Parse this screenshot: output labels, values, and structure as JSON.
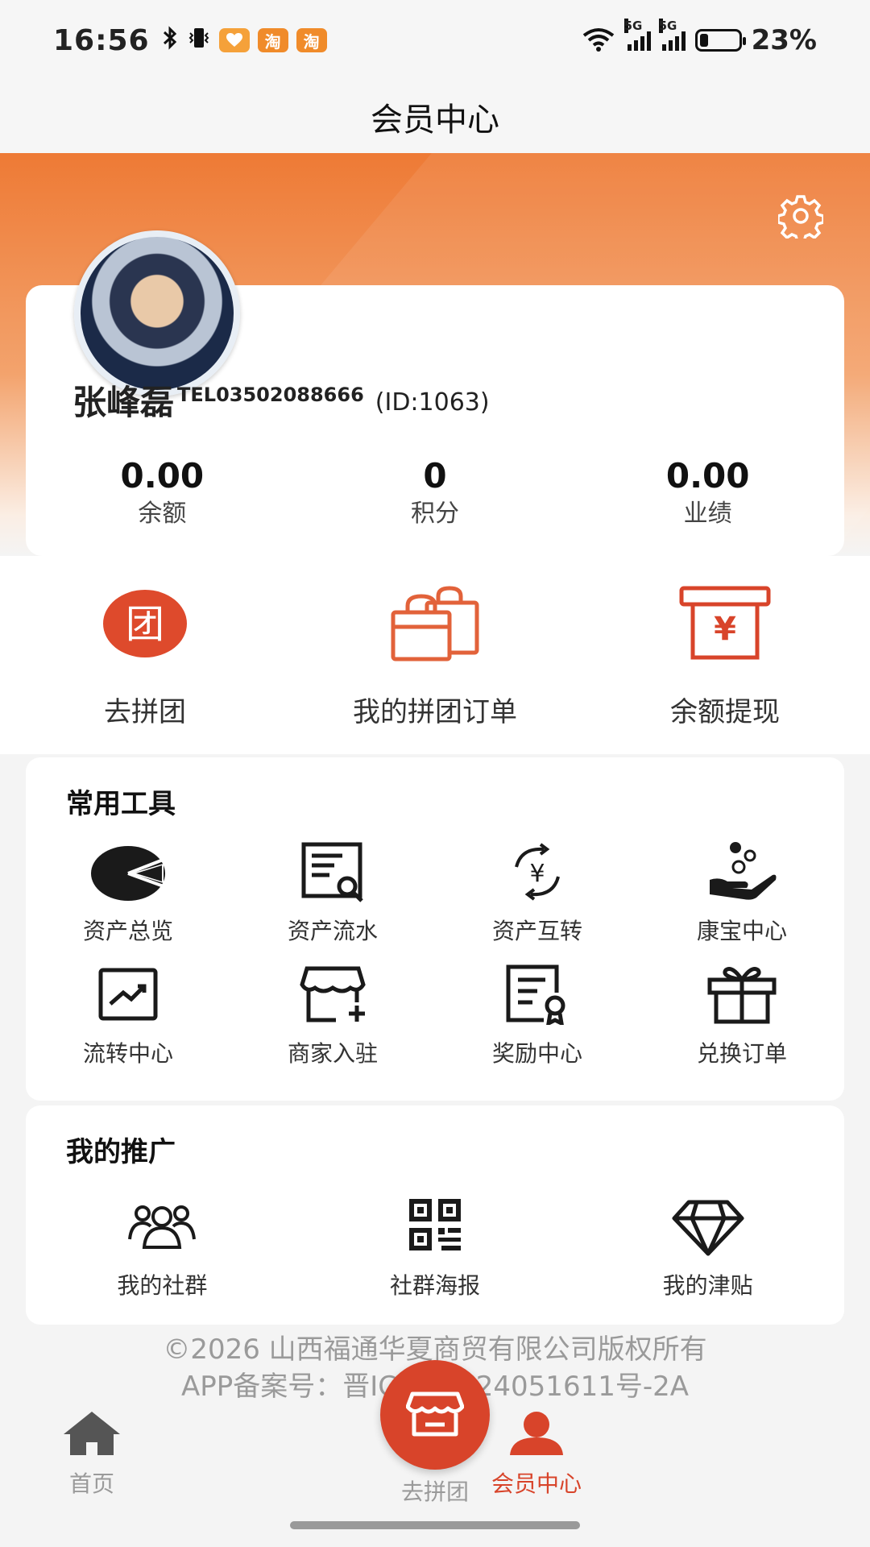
{
  "status_bar": {
    "time": "16:56",
    "app_badge_1": "淘",
    "app_badge_2": "淘",
    "network_1": "5G",
    "network_2": "5G",
    "battery_percent": "23%",
    "battery_level": 0.23
  },
  "header": {
    "title": "会员中心"
  },
  "profile": {
    "name": "张峰磊",
    "tel": "TEL03502088666",
    "id_text": "(ID:1063)"
  },
  "stats": [
    {
      "value": "0.00",
      "label": "余额"
    },
    {
      "value": "0",
      "label": "积分"
    },
    {
      "value": "0.00",
      "label": "业绩"
    }
  ],
  "quick_actions": [
    {
      "label": "去拼团",
      "icon": "group-buy-icon",
      "glyph": "团"
    },
    {
      "label": "我的拼团订单",
      "icon": "shopping-bags-icon"
    },
    {
      "label": "余额提现",
      "icon": "withdraw-icon",
      "glyph": "¥"
    }
  ],
  "tools": {
    "title": "常用工具",
    "items": [
      {
        "label": "资产总览",
        "icon": "pie-chart-icon"
      },
      {
        "label": "资产流水",
        "icon": "ledger-search-icon"
      },
      {
        "label": "资产互转",
        "icon": "currency-exchange-icon"
      },
      {
        "label": "康宝中心",
        "icon": "hand-coins-icon"
      },
      {
        "label": "流转中心",
        "icon": "trend-chart-icon"
      },
      {
        "label": "商家入驻",
        "icon": "store-add-icon"
      },
      {
        "label": "奖励中心",
        "icon": "certificate-icon"
      },
      {
        "label": "兑换订单",
        "icon": "gift-icon"
      }
    ]
  },
  "promotion": {
    "title": "我的推广",
    "items": [
      {
        "label": "我的社群",
        "icon": "community-icon"
      },
      {
        "label": "社群海报",
        "icon": "qr-code-icon"
      },
      {
        "label": "我的津贴",
        "icon": "diamond-icon"
      }
    ]
  },
  "footer": {
    "copyright_line1": "©2026 山西福通华夏商贸有限公司版权所有",
    "copyright_line2": "APP备案号：晋ICP备2024051611号-2A"
  },
  "tab_bar": {
    "tabs": [
      {
        "label": "首页",
        "icon": "home-icon"
      },
      {
        "label": "去拼团",
        "icon": "store-icon"
      },
      {
        "label": "会员中心",
        "icon": "user-icon"
      }
    ],
    "active_color": "#d8442a",
    "inactive_color": "#9a9a9a"
  },
  "colors": {
    "accent": "#d8442a",
    "hero": "#ee7a35"
  }
}
